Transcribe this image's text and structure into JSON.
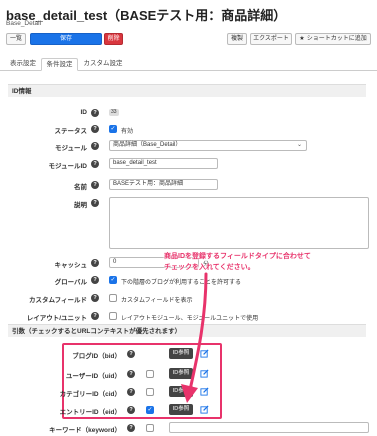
{
  "header": {
    "title": "base_detail_test（BASEテスト用：商品詳細）",
    "subtitle": "Base_Detail"
  },
  "toolbar": {
    "list_label": "一覧",
    "save_label": "保存",
    "delete_label": "削除",
    "copy_label": "複製",
    "export_label": "エクスポート",
    "shortcut_label": "ショートカットに追加"
  },
  "tabs": [
    "表示設定",
    "条件設定",
    "カスタム設定"
  ],
  "id_section": {
    "heading": "ID情報",
    "id_label": "ID",
    "id_value": "33",
    "status_label": "ステータス",
    "status_value": "有効",
    "module_label": "モジュール",
    "module_value": "商品詳細（Base_Detail）",
    "module_id_label": "モジュールID",
    "module_id_value": "base_detail_test",
    "name_label": "名前",
    "name_value": "BASEテスト用：商品詳細",
    "description_label": "説明",
    "cache_label": "キャッシュ",
    "cache_value": "0",
    "cache_unit": "分",
    "global_label": "グローバル",
    "global_text": "下の階層のブログが利用することを許可する",
    "custom_field_label": "カスタムフィールド",
    "custom_field_text": "カスタムフィールドを表示",
    "layout_label": "レイアウト/ユニット",
    "layout_text": "レイアウトモジュール、モジュールユニットで使用"
  },
  "args_section": {
    "heading": "引数（チェックするとURLコンテキストが優先されます）",
    "rows": [
      {
        "label": "ブログID（bid）",
        "button": "ID参照",
        "checked": false,
        "has_checkbox": false
      },
      {
        "label": "ユーザーID（uid）",
        "button": "ID参照",
        "checked": false,
        "has_checkbox": true
      },
      {
        "label": "カテゴリーID（cid）",
        "button": "ID参照",
        "checked": false,
        "has_checkbox": true
      },
      {
        "label": "エントリーID（eid）",
        "button": "ID参照",
        "checked": true,
        "has_checkbox": true
      }
    ],
    "keyword_label": "キーワード（keyword）"
  },
  "annotation": {
    "line1": "商品IDを登録するフィールドタイプに合わせて",
    "line2": "チェックを入れてください。",
    "color": "#e8336b"
  },
  "colors": {
    "primary": "#1a73e8",
    "danger": "#d9363e",
    "highlight": "#e8336b"
  }
}
